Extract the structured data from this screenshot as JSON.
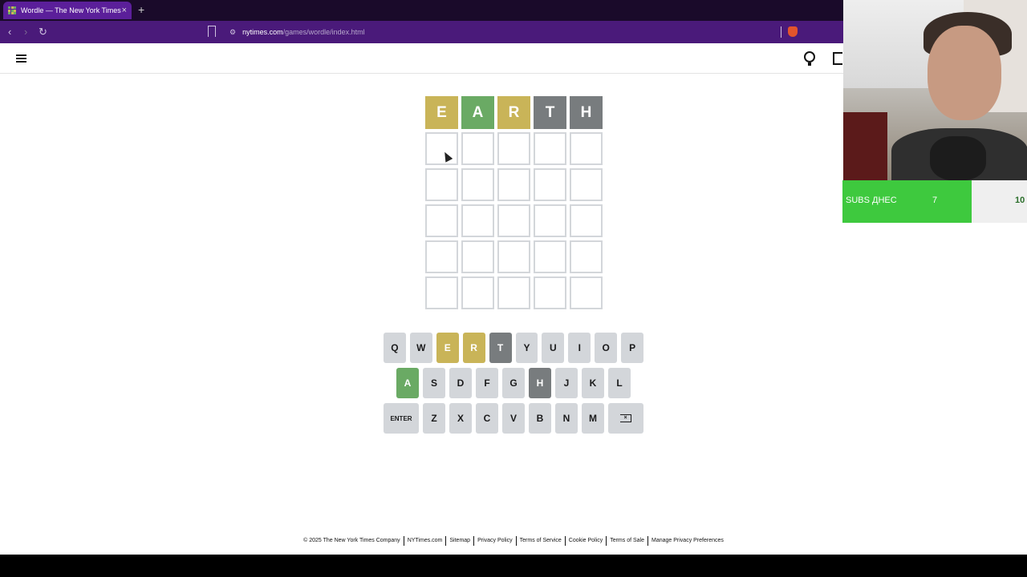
{
  "browser": {
    "tab_title": "Wordle — The New York Times",
    "tab_close": "×",
    "new_tab": "+",
    "url_domain": "nytimes.com",
    "url_path": "/games/wordle/index.html"
  },
  "board": {
    "rows": [
      [
        {
          "letter": "E",
          "state": "present"
        },
        {
          "letter": "A",
          "state": "correct"
        },
        {
          "letter": "R",
          "state": "present"
        },
        {
          "letter": "T",
          "state": "absent"
        },
        {
          "letter": "H",
          "state": "absent"
        }
      ],
      [
        {
          "letter": "",
          "state": "empty"
        },
        {
          "letter": "",
          "state": "empty"
        },
        {
          "letter": "",
          "state": "empty"
        },
        {
          "letter": "",
          "state": "empty"
        },
        {
          "letter": "",
          "state": "empty"
        }
      ],
      [
        {
          "letter": "",
          "state": "empty"
        },
        {
          "letter": "",
          "state": "empty"
        },
        {
          "letter": "",
          "state": "empty"
        },
        {
          "letter": "",
          "state": "empty"
        },
        {
          "letter": "",
          "state": "empty"
        }
      ],
      [
        {
          "letter": "",
          "state": "empty"
        },
        {
          "letter": "",
          "state": "empty"
        },
        {
          "letter": "",
          "state": "empty"
        },
        {
          "letter": "",
          "state": "empty"
        },
        {
          "letter": "",
          "state": "empty"
        }
      ],
      [
        {
          "letter": "",
          "state": "empty"
        },
        {
          "letter": "",
          "state": "empty"
        },
        {
          "letter": "",
          "state": "empty"
        },
        {
          "letter": "",
          "state": "empty"
        },
        {
          "letter": "",
          "state": "empty"
        }
      ],
      [
        {
          "letter": "",
          "state": "empty"
        },
        {
          "letter": "",
          "state": "empty"
        },
        {
          "letter": "",
          "state": "empty"
        },
        {
          "letter": "",
          "state": "empty"
        },
        {
          "letter": "",
          "state": "empty"
        }
      ]
    ]
  },
  "keyboard": {
    "rows": [
      [
        {
          "label": "Q",
          "state": ""
        },
        {
          "label": "W",
          "state": ""
        },
        {
          "label": "E",
          "state": "present"
        },
        {
          "label": "R",
          "state": "present"
        },
        {
          "label": "T",
          "state": "absent"
        },
        {
          "label": "Y",
          "state": ""
        },
        {
          "label": "U",
          "state": ""
        },
        {
          "label": "I",
          "state": ""
        },
        {
          "label": "O",
          "state": ""
        },
        {
          "label": "P",
          "state": ""
        }
      ],
      [
        {
          "label": "A",
          "state": "correct"
        },
        {
          "label": "S",
          "state": ""
        },
        {
          "label": "D",
          "state": ""
        },
        {
          "label": "F",
          "state": ""
        },
        {
          "label": "G",
          "state": ""
        },
        {
          "label": "H",
          "state": "absent"
        },
        {
          "label": "J",
          "state": ""
        },
        {
          "label": "K",
          "state": ""
        },
        {
          "label": "L",
          "state": ""
        }
      ],
      [
        {
          "label": "ENTER",
          "state": "",
          "wide": true
        },
        {
          "label": "Z",
          "state": ""
        },
        {
          "label": "X",
          "state": ""
        },
        {
          "label": "C",
          "state": ""
        },
        {
          "label": "V",
          "state": ""
        },
        {
          "label": "B",
          "state": ""
        },
        {
          "label": "N",
          "state": ""
        },
        {
          "label": "M",
          "state": ""
        },
        {
          "label": "",
          "state": "",
          "wide": true,
          "icon": "backspace-icon"
        }
      ]
    ]
  },
  "footer": {
    "links": [
      "© 2025 The New York Times Company",
      "NYTimes.com",
      "Sitemap",
      "Privacy Policy",
      "Terms of Service",
      "Cookie Policy",
      "Terms of Sale",
      "Manage Privacy Preferences"
    ]
  },
  "overlay": {
    "subs_label": "SUBS ДНЕС",
    "subs_current": "7",
    "subs_goal": "10",
    "subs_progress": 0.7,
    "fill_color": "#3ec93e"
  },
  "colors": {
    "correct": "#6aaa64",
    "present": "#c9b458",
    "absent": "#787c7e",
    "key_default": "#d3d6da"
  }
}
